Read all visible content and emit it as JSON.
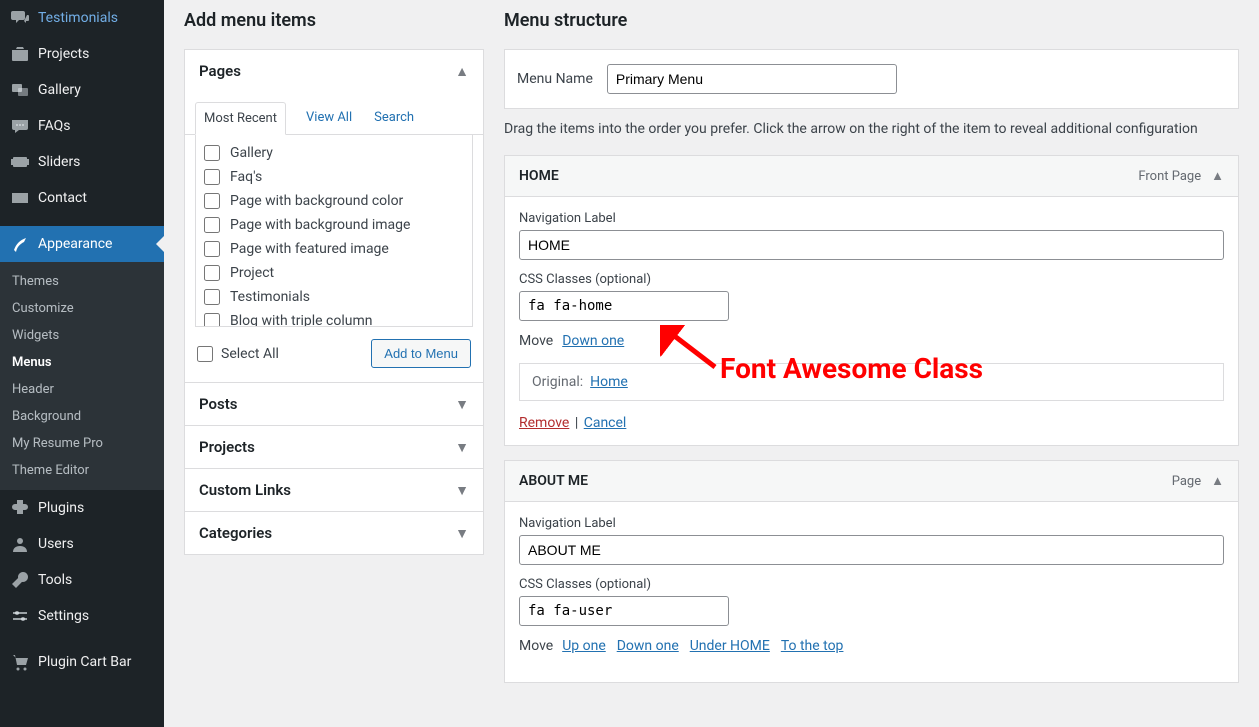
{
  "sidebar": {
    "items": [
      {
        "label": "Testimonials",
        "icon": "admin-comments"
      },
      {
        "label": "Projects",
        "icon": "portfolio"
      },
      {
        "label": "Gallery",
        "icon": "images"
      },
      {
        "label": "FAQs",
        "icon": "comment"
      },
      {
        "label": "Sliders",
        "icon": "slides"
      },
      {
        "label": "Contact",
        "icon": "email"
      },
      {
        "label": "Appearance",
        "icon": "brush",
        "current": true
      },
      {
        "label": "Plugins",
        "icon": "plugin"
      },
      {
        "label": "Users",
        "icon": "user"
      },
      {
        "label": "Tools",
        "icon": "tools"
      },
      {
        "label": "Settings",
        "icon": "settings"
      },
      {
        "label": "Plugin Cart Bar",
        "icon": "cart"
      }
    ],
    "submenu": [
      "Themes",
      "Customize",
      "Widgets",
      "Menus",
      "Header",
      "Background",
      "My Resume Pro",
      "Theme Editor"
    ],
    "submenu_current": "Menus"
  },
  "addItems": {
    "heading": "Add menu items",
    "pages": {
      "title": "Pages",
      "tabs": [
        "Most Recent",
        "View All",
        "Search"
      ],
      "active_tab": "Most Recent",
      "items": [
        "Gallery",
        "Faq's",
        "Page with background color",
        "Page with background image",
        "Page with featured image",
        "Project",
        "Testimonials",
        "Blog with triple column"
      ],
      "select_all": "Select All",
      "add_btn": "Add to Menu"
    },
    "sections": [
      "Posts",
      "Projects",
      "Custom Links",
      "Categories"
    ]
  },
  "structure": {
    "heading": "Menu structure",
    "name_label": "Menu Name",
    "name_value": "Primary Menu",
    "instructions": "Drag the items into the order you prefer. Click the arrow on the right of the item to reveal additional configuration",
    "items": [
      {
        "title": "HOME",
        "type": "Front Page",
        "nav_label_label": "Navigation Label",
        "nav_label": "HOME",
        "css_label": "CSS Classes (optional)",
        "css": "fa fa-home",
        "move_label": "Move",
        "move_links": [
          "Down one"
        ],
        "original_label": "Original:",
        "original": "Home",
        "remove": "Remove",
        "cancel": "Cancel"
      },
      {
        "title": "ABOUT ME",
        "type": "Page",
        "nav_label_label": "Navigation Label",
        "nav_label": "ABOUT ME",
        "css_label": "CSS Classes (optional)",
        "css": "fa fa-user",
        "move_label": "Move",
        "move_links": [
          "Up one",
          "Down one",
          "Under HOME",
          "To the top"
        ]
      }
    ]
  },
  "annotation": {
    "text": "Font Awesome Class"
  }
}
